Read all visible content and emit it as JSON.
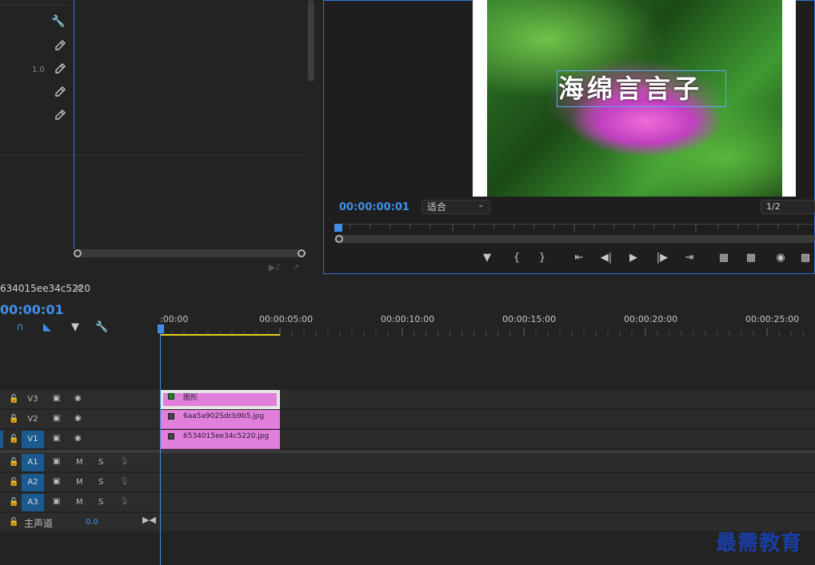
{
  "effect_controls": {
    "value": "1.0",
    "icons": [
      "wrench-icon",
      "eyedropper-icon",
      "eyedropper-icon",
      "eyedropper-icon",
      "eyedropper-icon"
    ]
  },
  "program_monitor": {
    "title_text": "海绵言言子",
    "timecode": "00:00:00:01",
    "fit_label": "适合",
    "resolution": "1/2"
  },
  "timeline": {
    "sequence_name": "634015ee34c5220",
    "timecode": "00:00:01",
    "ruler_labels": [
      ":00:00",
      "00:00:05:00",
      "00:00:10:00",
      "00:00:15:00",
      "00:00:20:00",
      "00:00:25:00"
    ],
    "video_tracks": [
      {
        "name": "V3",
        "clip": "图形"
      },
      {
        "name": "V2",
        "clip": "6aa5a902Sdcb9b5.jpg"
      },
      {
        "name": "V1",
        "clip": "6534015ee34c5220.jpg"
      }
    ],
    "audio_tracks": [
      {
        "name": "A1",
        "m": "M",
        "s": "S"
      },
      {
        "name": "A2",
        "m": "M",
        "s": "S"
      },
      {
        "name": "A3",
        "m": "M",
        "s": "S"
      }
    ],
    "master": {
      "label": "主声道",
      "value": "0.0"
    }
  },
  "watermark": "最需教育",
  "colors": {
    "accent_blue": "#3f8fe8",
    "clip_pink": "#e07fdc",
    "work_area_yellow": "#e3d11a"
  }
}
